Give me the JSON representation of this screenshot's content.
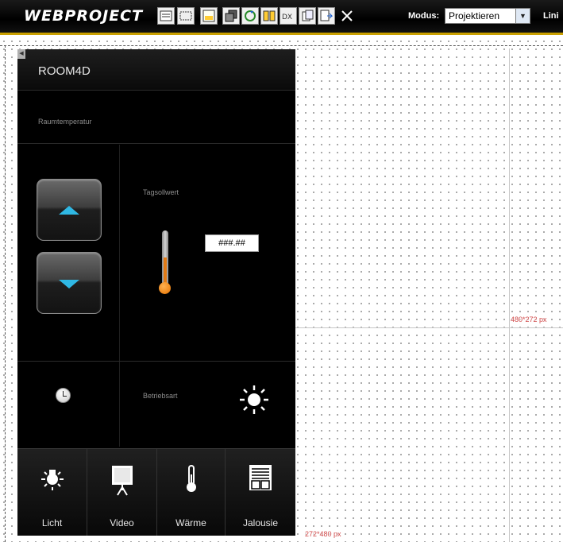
{
  "toolbar": {
    "brand": "WEBPROJECT",
    "mode_label": "Modus:",
    "mode_value": "Projektieren",
    "cut_label": "Lini"
  },
  "canvas": {
    "dim_landscape": "480*272 px",
    "dim_portrait": "272*480 px"
  },
  "panel": {
    "title": "ROOM4D",
    "section": "Raumtemperatur",
    "setpoint_label": "Tagsollwert",
    "setpoint_value": "###.##",
    "mode_label": "Betriebsart",
    "nav": [
      {
        "label": "Licht"
      },
      {
        "label": "Video"
      },
      {
        "label": "Wärme"
      },
      {
        "label": "Jalousie"
      }
    ]
  },
  "colors": {
    "accent_blue": "#2fb8e4",
    "thermo_orange": "#e27a15",
    "toolbar_border": "#c9a000"
  }
}
